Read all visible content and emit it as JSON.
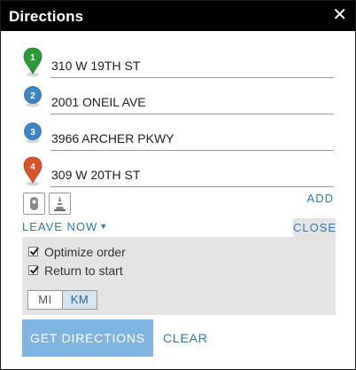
{
  "titlebar": {
    "title": "Directions",
    "close_glyph": "✕"
  },
  "stops": [
    {
      "number": "1",
      "address": "310 W 19TH ST",
      "pin": "green-start-pin-icon",
      "color": "#2a9a35"
    },
    {
      "number": "2",
      "address": "2001 ONEIL AVE",
      "pin": "blue-waypoint-icon",
      "color": "#3c86c8"
    },
    {
      "number": "3",
      "address": "3966 ARCHER PKWY",
      "pin": "blue-waypoint-icon",
      "color": "#3c86c8"
    },
    {
      "number": "4",
      "address": "309 W 20TH ST",
      "pin": "red-end-pin-icon",
      "color": "#d9542b"
    }
  ],
  "toolbar": {
    "travel_mode_icon": "car-marker-icon",
    "barrier_icon": "traffic-cone-icon",
    "add_label": "ADD"
  },
  "depart": {
    "label": "LEAVE NOW",
    "caret": "▼",
    "close_label": "CLOSE"
  },
  "options": {
    "optimize": {
      "label": "Optimize order",
      "checked": true
    },
    "return_to_start": {
      "label": "Return to start",
      "checked": true
    },
    "units": [
      "MI",
      "KM"
    ],
    "selected_unit": "KM"
  },
  "actions": {
    "get_directions": "GET DIRECTIONS",
    "clear": "CLEAR"
  },
  "colors": {
    "accent": "#2a7ab8",
    "button": "#7fb5e0",
    "options_bg": "#e4e4e4"
  }
}
